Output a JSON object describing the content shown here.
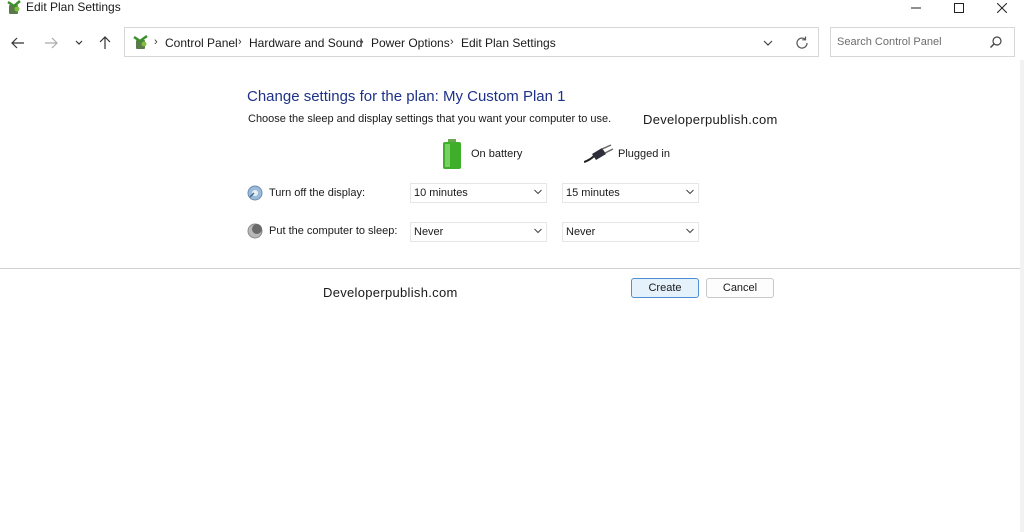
{
  "window": {
    "title": "Edit Plan Settings",
    "controls": [
      "minimize",
      "maximize",
      "close"
    ]
  },
  "navigation": {
    "breadcrumb": [
      "Control Panel",
      "Hardware and Sound",
      "Power Options",
      "Edit Plan Settings"
    ],
    "search_placeholder": "Search Control Panel"
  },
  "content": {
    "heading": "Change settings for the plan: My Custom Plan 1",
    "description": "Choose the sleep and display settings that you want your computer to use.",
    "columns": {
      "battery": "On battery",
      "plugged": "Plugged in"
    },
    "rows": [
      {
        "label": "Turn off the display:",
        "battery": "10 minutes",
        "plugged": "15 minutes"
      },
      {
        "label": "Put the computer to sleep:",
        "battery": "Never",
        "plugged": "Never"
      }
    ],
    "buttons": {
      "create": "Create",
      "cancel": "Cancel"
    }
  },
  "watermarks": [
    "Developerpublish.com",
    "Developerpublish.com"
  ],
  "colors": {
    "heading": "#1e3287",
    "primary_button_border": "#4f8fd2",
    "primary_button_fill": "#e5f1fb"
  },
  "icons": {
    "app": "power-options-icon",
    "battery": "battery-icon",
    "plug": "power-plug-icon",
    "display": "display-icon",
    "sleep": "sleep-moon-icon",
    "search": "search-icon"
  }
}
